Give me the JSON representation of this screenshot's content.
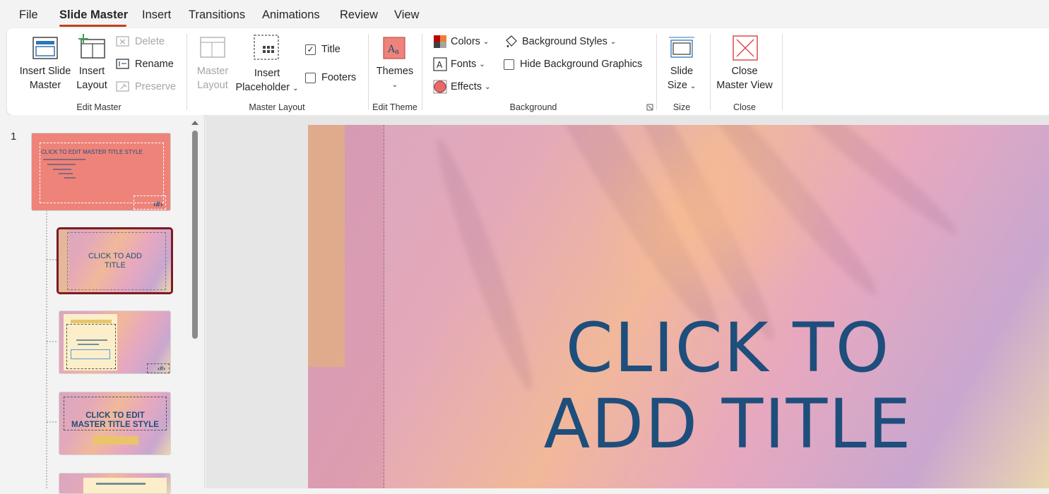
{
  "tabs": [
    {
      "label": "File"
    },
    {
      "label": "Slide Master"
    },
    {
      "label": "Insert"
    },
    {
      "label": "Transitions"
    },
    {
      "label": "Animations"
    },
    {
      "label": "Review"
    },
    {
      "label": "View"
    }
  ],
  "ribbon": {
    "edit_master": {
      "insert_slide_master": [
        "Insert Slide",
        "Master"
      ],
      "insert_layout": [
        "Insert",
        "Layout"
      ],
      "delete": "Delete",
      "rename": "Rename",
      "preserve": "Preserve",
      "label": "Edit Master"
    },
    "master_layout": {
      "master_layout_btn": [
        "Master",
        "Layout"
      ],
      "insert_placeholder": [
        "Insert",
        "Placeholder"
      ],
      "title_checkbox": "Title",
      "title_checked": true,
      "footers_checkbox": "Footers",
      "footers_checked": false,
      "label": "Master Layout"
    },
    "edit_theme": {
      "themes": "Themes",
      "label": "Edit Theme"
    },
    "background": {
      "colors": "Colors",
      "fonts": "Fonts",
      "effects": "Effects",
      "background_styles": "Background Styles",
      "hide_background_graphics": "Hide Background Graphics",
      "hide_checked": false,
      "label": "Background"
    },
    "size": {
      "slide_size": [
        "Slide",
        "Size"
      ],
      "label": "Size"
    },
    "close": {
      "close_master_view": [
        "Close",
        "Master View"
      ],
      "label": "Close"
    }
  },
  "thumbnails": {
    "master_number": "1",
    "master_title": "CLICK TO EDIT MASTER TITLE STYLE",
    "master_page_num": "‹#›",
    "layout1_title": "CLICK TO ADD TITLE",
    "layout3_title": "CLICK TO EDIT MASTER TITLE STYLE"
  },
  "slide": {
    "title_line1": "CLICK TO",
    "title_line2": "ADD TITLE"
  },
  "colors": {
    "accent": "#c43e1c",
    "title_blue": "#1e4e7c",
    "master_thumb": "#ee837a",
    "selected_border": "#7b1c25"
  }
}
